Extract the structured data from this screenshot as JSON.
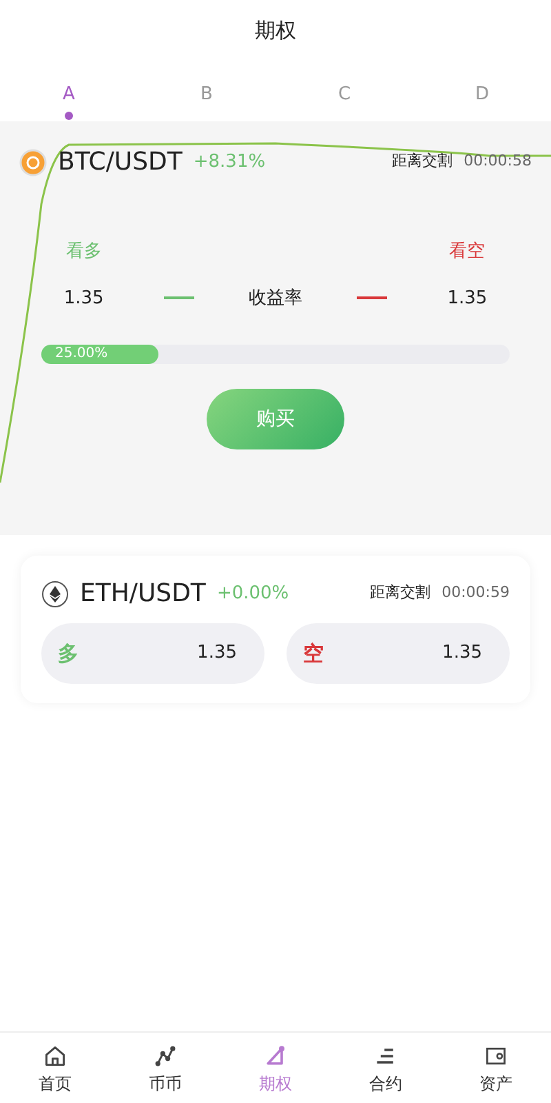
{
  "header": {
    "title": "期权"
  },
  "tabs": [
    {
      "label": "A",
      "selected": true
    },
    {
      "label": "B",
      "selected": false
    },
    {
      "label": "C",
      "selected": false
    },
    {
      "label": "D",
      "selected": false
    }
  ],
  "featured": {
    "pair": "BTC/USDT",
    "kind": "btc",
    "change": "+8.31%",
    "countdown_label": "距离交割",
    "countdown": "00:00:58",
    "long_label": "看多",
    "short_label": "看空",
    "long_value": "1.35",
    "rate_label": "收益率",
    "short_value": "1.35",
    "level": 0.25,
    "long_share": "25.00%",
    "buy_button": "购买"
  },
  "markets": [
    {
      "pair": "ETH/USDT",
      "kind": "eth",
      "change": "+0.00%",
      "countdown_label": "距离交割",
      "countdown": "00:00:59",
      "long_label": "多",
      "long_value": "1.35",
      "short_label": "空",
      "short_value": "1.35"
    }
  ],
  "bottom_nav": [
    {
      "label": "首页",
      "kind": "home",
      "selected": false
    },
    {
      "label": "币币",
      "kind": "spot",
      "selected": false
    },
    {
      "label": "期权",
      "kind": "options",
      "selected": true
    },
    {
      "label": "合约",
      "kind": "contract",
      "selected": false
    },
    {
      "label": "资产",
      "kind": "assets",
      "selected": false
    }
  ]
}
